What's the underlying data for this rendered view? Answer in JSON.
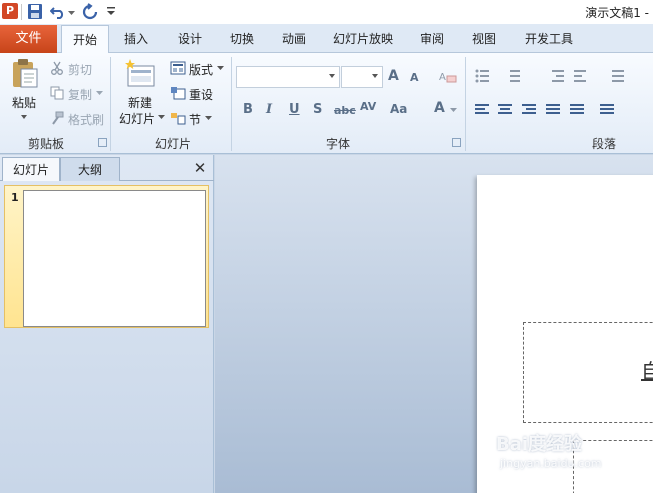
{
  "window": {
    "title": "演示文稿1 -"
  },
  "tabs": {
    "file": "文件",
    "items": [
      "开始",
      "插入",
      "设计",
      "切换",
      "动画",
      "幻灯片放映",
      "审阅",
      "视图",
      "开发工具"
    ]
  },
  "ribbon": {
    "clipboard": {
      "label": "剪贴板",
      "paste": "粘贴",
      "cut": "剪切",
      "copy": "复制",
      "format_painter": "格式刷"
    },
    "slides": {
      "label": "幻灯片",
      "new_slide_line1": "新建",
      "new_slide_line2": "幻灯片",
      "layout": "版式",
      "reset": "重设",
      "section": "节"
    },
    "font": {
      "label": "字体",
      "bold": "B",
      "italic": "I",
      "underline": "U",
      "shadow": "S",
      "strikethrough": "abc",
      "spacing": "AV",
      "case": "Aa",
      "color": "A",
      "grow": "A",
      "shrink": "A"
    },
    "paragraph": {
      "label": "段落"
    }
  },
  "left_pane": {
    "tab_slides": "幻灯片",
    "tab_outline": "大纲",
    "close": "✕",
    "slide_number": "1"
  },
  "slide": {
    "title_partial": "自"
  },
  "watermark": {
    "text": "Bai度经验",
    "url": "jingyan.baidu.com"
  },
  "colors": {
    "file_tab": "#d24726",
    "ribbon": "#e3ecf7",
    "selected_thumb": "#ffe490"
  }
}
